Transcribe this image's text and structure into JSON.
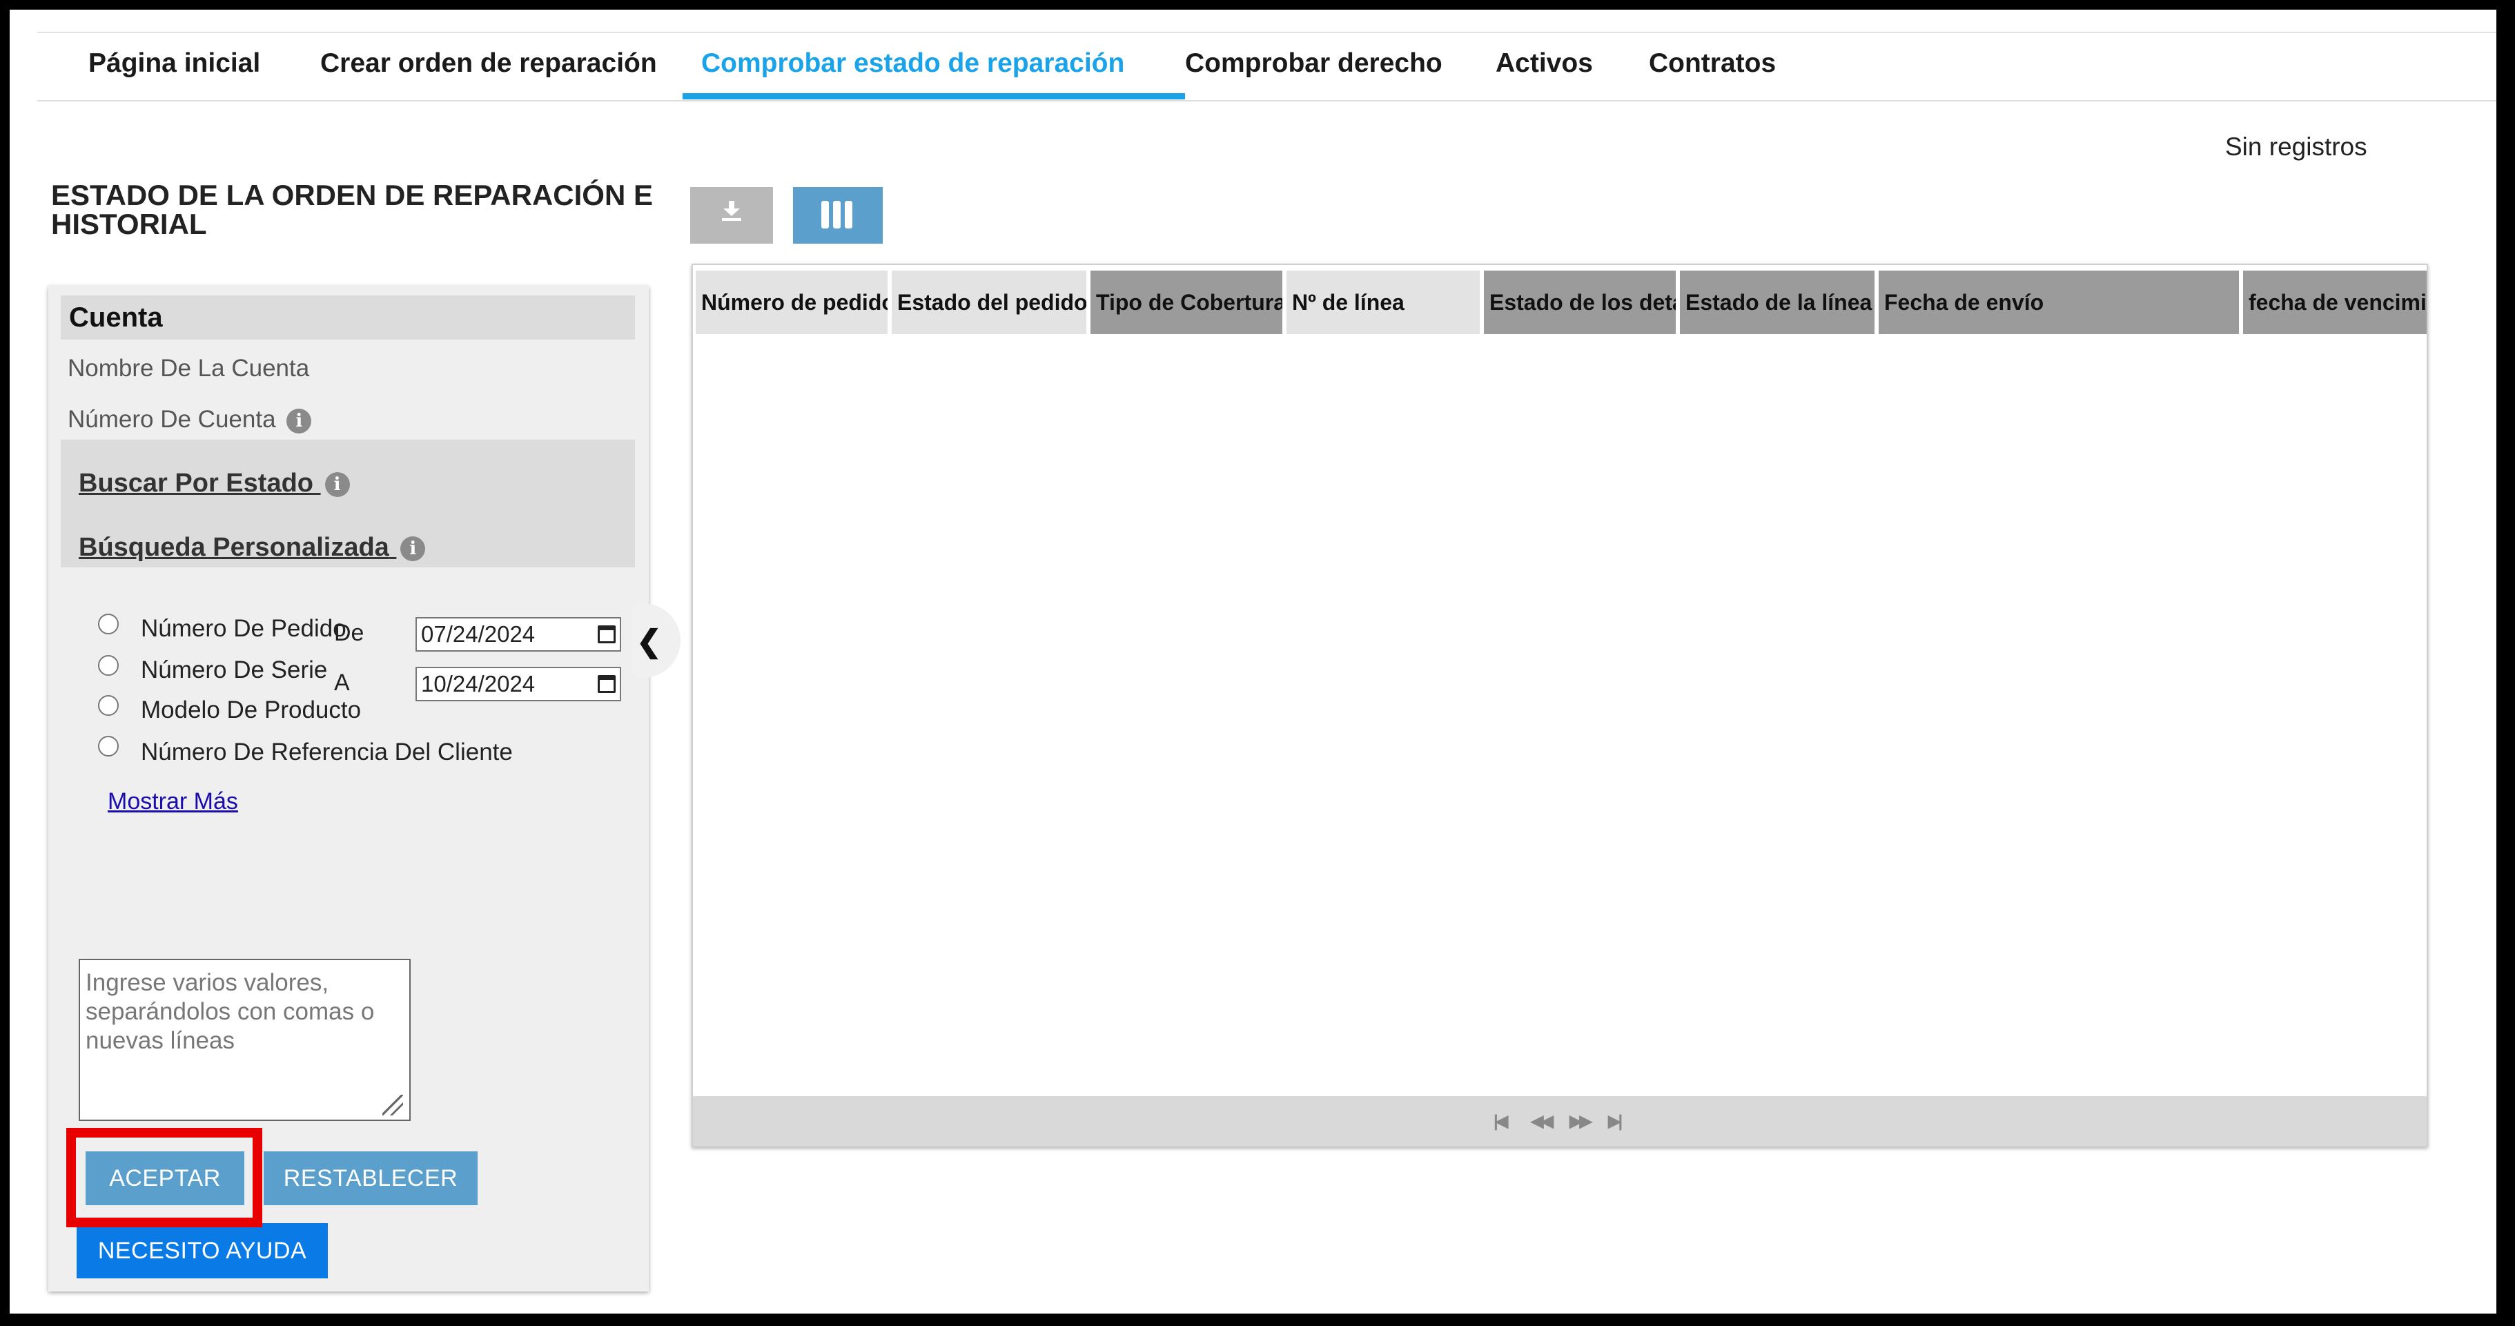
{
  "nav": {
    "tabs": [
      {
        "label": "Página inicial"
      },
      {
        "label": "Crear orden de reparación"
      },
      {
        "label": "Comprobar estado de reparación"
      },
      {
        "label": "Comprobar derecho"
      },
      {
        "label": "Activos"
      },
      {
        "label": "Contratos"
      }
    ],
    "active_index": 2
  },
  "status": {
    "records": "Sin registros"
  },
  "page": {
    "title": "ESTADO DE LA ORDEN DE REPARACIÓN E HISTORIAL"
  },
  "sidebar": {
    "account_header": "Cuenta",
    "account_name_label": "Nombre De La Cuenta",
    "account_number_label": "Número De Cuenta",
    "search_by_status": "Buscar Por Estado",
    "custom_search": "Búsqueda Personalizada",
    "radio_options": [
      {
        "label": "Número De Pedido"
      },
      {
        "label": "Número De Serie"
      },
      {
        "label": "Modelo De Producto"
      },
      {
        "label": "Número De Referencia Del Cliente"
      }
    ],
    "date_from_label": "De",
    "date_to_label": "A",
    "date_from": "07/24/2024",
    "date_to": "10/24/2024",
    "show_more": "Mostrar Más",
    "textarea_placeholder": "Ingrese varios valores, separándolos con comas o nuevas líneas",
    "accept_button": "ACEPTAR",
    "reset_button": "RESTABLECER",
    "help_button": "NECESITO AYUDA"
  },
  "grid": {
    "columns": [
      {
        "label": "Número de pedido"
      },
      {
        "label": "Estado del pedido"
      },
      {
        "label": "Tipo de Cobertura"
      },
      {
        "label": "Nº de línea"
      },
      {
        "label": "Estado de los detal"
      },
      {
        "label": "Estado de la línea"
      },
      {
        "label": "Fecha de envío"
      },
      {
        "label": "fecha de vencimi"
      }
    ],
    "rows": []
  },
  "colors": {
    "accent": "#1aa3e8",
    "button": "#5b9fcd",
    "help_button": "#0a7ae6",
    "highlight": "#e80000"
  }
}
